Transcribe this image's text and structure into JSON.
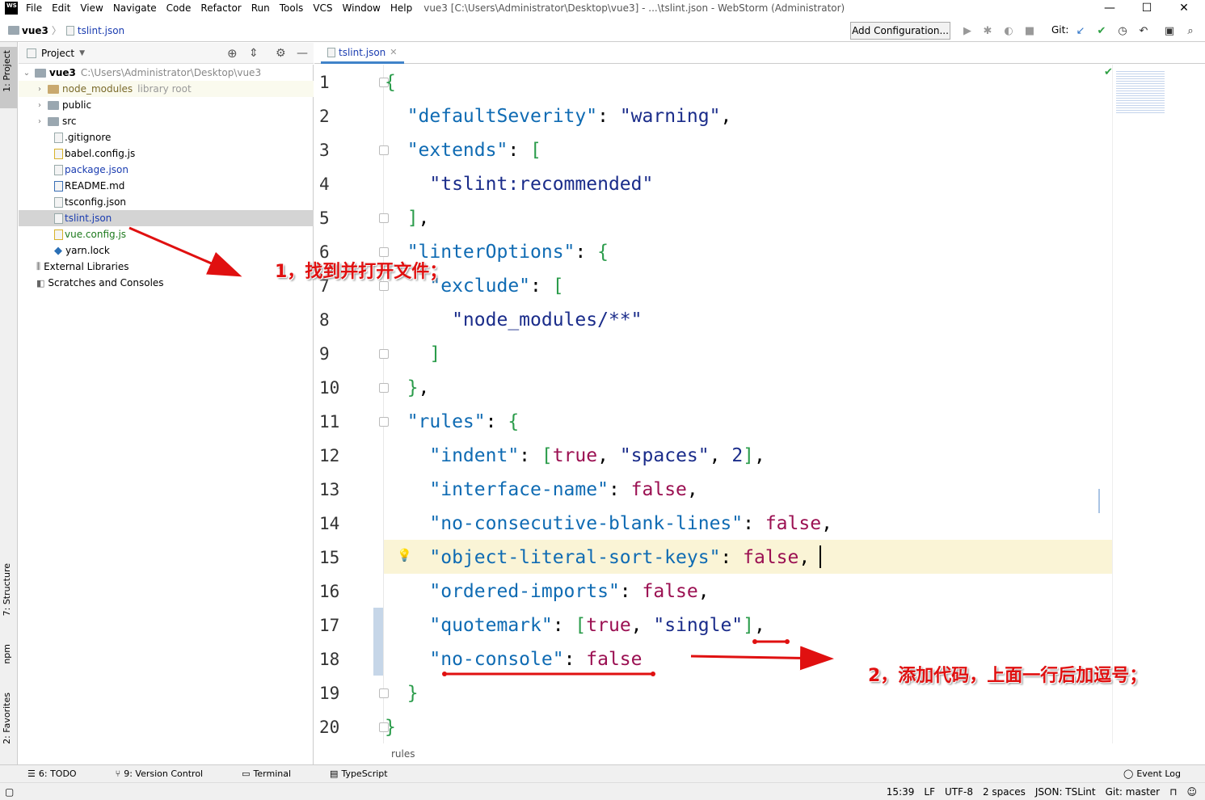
{
  "window": {
    "logo": "WS",
    "menu": [
      "File",
      "Edit",
      "View",
      "Navigate",
      "Code",
      "Refactor",
      "Run",
      "Tools",
      "VCS",
      "Window",
      "Help"
    ],
    "title": "vue3 [C:\\Users\\Administrator\\Desktop\\vue3] - ...\\tslint.json - WebStorm (Administrator)",
    "minimize": "—",
    "maximize": "☐",
    "close": "✕"
  },
  "navbar": {
    "project": "vue3",
    "file": "tslint.json",
    "add_configuration": "Add Configuration...",
    "git_label": "Git:"
  },
  "left_strip": {
    "project_tab": "1: Project",
    "structure_tab": "7: Structure",
    "npm_tab": "npm",
    "favorites_tab": "2: Favorites"
  },
  "project_panel": {
    "header": "Project",
    "root": {
      "name": "vue3",
      "path": "C:\\Users\\Administrator\\Desktop\\vue3"
    },
    "items": [
      {
        "name": "node_modules",
        "extra": "library root",
        "kind": "folder",
        "expandable": true
      },
      {
        "name": "public",
        "kind": "folder",
        "expandable": true
      },
      {
        "name": "src",
        "kind": "folder",
        "expandable": true
      },
      {
        "name": ".gitignore",
        "kind": "file"
      },
      {
        "name": "babel.config.js",
        "kind": "js"
      },
      {
        "name": "package.json",
        "kind": "json"
      },
      {
        "name": "README.md",
        "kind": "md"
      },
      {
        "name": "tsconfig.json",
        "kind": "json"
      },
      {
        "name": "tslint.json",
        "kind": "json",
        "selected": true
      },
      {
        "name": "vue.config.js",
        "kind": "js"
      },
      {
        "name": "yarn.lock",
        "kind": "lock"
      }
    ],
    "external_libraries": "External Libraries",
    "scratches": "Scratches and Consoles"
  },
  "editor": {
    "tab_label": "tslint.json",
    "current_line": 15,
    "lines": [
      {
        "n": "1",
        "segs": [
          [
            "g",
            "{"
          ]
        ]
      },
      {
        "n": "2",
        "segs": [
          [
            "k",
            "  \"defaultSeverity\""
          ],
          [
            "p",
            ": "
          ],
          [
            "s",
            "\"warning\""
          ],
          [
            "p",
            ","
          ]
        ]
      },
      {
        "n": "3",
        "segs": [
          [
            "k",
            "  \"extends\""
          ],
          [
            "p",
            ": "
          ],
          [
            "g",
            "["
          ]
        ]
      },
      {
        "n": "4",
        "segs": [
          [
            "s",
            "    \"tslint:recommended\""
          ]
        ]
      },
      {
        "n": "5",
        "segs": [
          [
            "g",
            "  ]"
          ],
          [
            "p",
            ","
          ]
        ]
      },
      {
        "n": "6",
        "segs": [
          [
            "k",
            "  \"linterOptions\""
          ],
          [
            "p",
            ": "
          ],
          [
            "g",
            "{"
          ]
        ]
      },
      {
        "n": "7",
        "segs": [
          [
            "k",
            "    \"exclude\""
          ],
          [
            "p",
            ": "
          ],
          [
            "g",
            "["
          ]
        ]
      },
      {
        "n": "8",
        "segs": [
          [
            "s",
            "      \"node_modules/**\""
          ]
        ]
      },
      {
        "n": "9",
        "segs": [
          [
            "g",
            "    ]"
          ]
        ]
      },
      {
        "n": "10",
        "segs": [
          [
            "g",
            "  }"
          ],
          [
            "p",
            ","
          ]
        ]
      },
      {
        "n": "11",
        "segs": [
          [
            "k",
            "  \"rules\""
          ],
          [
            "p",
            ": "
          ],
          [
            "g",
            "{"
          ]
        ]
      },
      {
        "n": "12",
        "segs": [
          [
            "k",
            "    \"indent\""
          ],
          [
            "p",
            ": "
          ],
          [
            "g",
            "["
          ],
          [
            "b",
            "true"
          ],
          [
            "p",
            ", "
          ],
          [
            "s",
            "\"spaces\""
          ],
          [
            "p",
            ", "
          ],
          [
            "s",
            "2"
          ],
          [
            "g",
            "]"
          ],
          [
            "p",
            ","
          ]
        ]
      },
      {
        "n": "13",
        "segs": [
          [
            "k",
            "    \"interface-name\""
          ],
          [
            "p",
            ": "
          ],
          [
            "b",
            "false"
          ],
          [
            "p",
            ","
          ]
        ]
      },
      {
        "n": "14",
        "segs": [
          [
            "k",
            "    \"no-consecutive-blank-lines\""
          ],
          [
            "p",
            ": "
          ],
          [
            "b",
            "false"
          ],
          [
            "p",
            ","
          ]
        ]
      },
      {
        "n": "15",
        "segs": [
          [
            "k",
            "    \"object-literal-sort-keys\""
          ],
          [
            "p",
            ": "
          ],
          [
            "b",
            "false"
          ],
          [
            "p",
            ","
          ]
        ]
      },
      {
        "n": "16",
        "segs": [
          [
            "k",
            "    \"ordered-imports\""
          ],
          [
            "p",
            ": "
          ],
          [
            "b",
            "false"
          ],
          [
            "p",
            ","
          ]
        ]
      },
      {
        "n": "17",
        "segs": [
          [
            "k",
            "    \"quotemark\""
          ],
          [
            "p",
            ": "
          ],
          [
            "g",
            "["
          ],
          [
            "b",
            "true"
          ],
          [
            "p",
            ", "
          ],
          [
            "s",
            "\"single\""
          ],
          [
            "g",
            "]"
          ],
          [
            "p",
            ","
          ]
        ]
      },
      {
        "n": "18",
        "segs": [
          [
            "k",
            "    \"no-console\""
          ],
          [
            "p",
            ": "
          ],
          [
            "b",
            "false"
          ]
        ]
      },
      {
        "n": "19",
        "segs": [
          [
            "g",
            "  }"
          ]
        ]
      },
      {
        "n": "20",
        "segs": [
          [
            "g",
            "}"
          ]
        ]
      }
    ],
    "breadcrumb": "rules"
  },
  "annotations": {
    "step1": "1，找到并打开文件；",
    "step2": "2，添加代码，上面一行后加逗号；"
  },
  "tool_windows": {
    "todo": "6: TODO",
    "vcs": "9: Version Control",
    "terminal": "Terminal",
    "typescript": "TypeScript",
    "event_log": "Event Log"
  },
  "status": {
    "position": "15:39",
    "line_sep": "LF",
    "encoding": "UTF-8",
    "indent": "2 spaces",
    "schema": "JSON: TSLint",
    "git": "Git: master"
  },
  "colors": {
    "key": "#0f6bb3",
    "string": "#1a2c8a",
    "bool": "#9b1052",
    "bracket": "#2b9c4b",
    "annotation": "#e01010",
    "current_line": "#faf4d6"
  }
}
